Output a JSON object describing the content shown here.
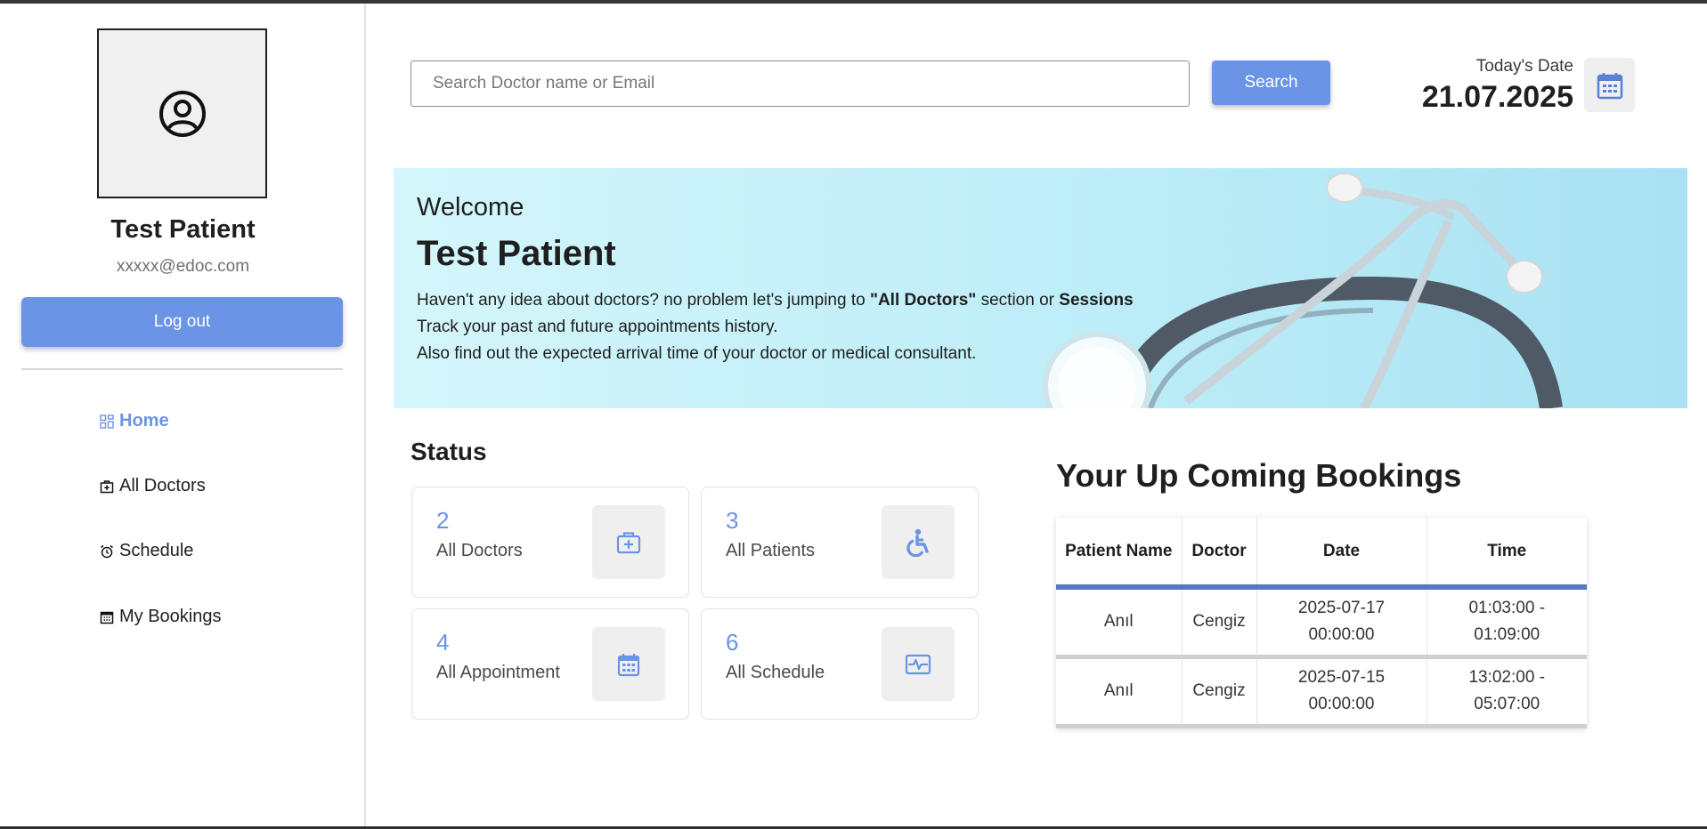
{
  "sidebar": {
    "profile_name": "Test Patient",
    "profile_email": "xxxxx@edoc.com",
    "logout_label": "Log out",
    "menu": [
      {
        "label": "Home",
        "icon": "dashboard-icon",
        "active": true
      },
      {
        "label": "All Doctors",
        "icon": "doctor-bag-icon",
        "active": false
      },
      {
        "label": "Schedule",
        "icon": "alarm-clock-icon",
        "active": false
      },
      {
        "label": "My Bookings",
        "icon": "calendar-icon",
        "active": false
      }
    ]
  },
  "topbar": {
    "search_placeholder": "Search Doctor name or Email",
    "search_label": "Search",
    "date_label": "Today's Date",
    "date_value": "21.07.2025"
  },
  "banner": {
    "welcome": "Welcome",
    "name": "Test Patient",
    "line1_prefix": "Haven't any idea about doctors? no problem let's jumping to ",
    "line1_bold1": "\"All Doctors\"",
    "line1_mid": " section or ",
    "line1_bold2": "Sessions",
    "line2": "Track your past and future appointments history.",
    "line3": "Also find out the expected arrival time of your doctor or medical consultant."
  },
  "status": {
    "title": "Status",
    "cards": [
      {
        "value": "2",
        "label": "All Doctors",
        "icon": "medical-bag-icon"
      },
      {
        "value": "3",
        "label": "All Patients",
        "icon": "wheelchair-icon"
      },
      {
        "value": "4",
        "label": "All Appointment",
        "icon": "calendar-icon"
      },
      {
        "value": "6",
        "label": "All Schedule",
        "icon": "heartbeat-icon"
      }
    ]
  },
  "bookings": {
    "title": "Your Up Coming Bookings",
    "headers": [
      "Patient Name",
      "Doctor",
      "Date",
      "Time"
    ],
    "rows": [
      {
        "patient": "Anıl",
        "doctor": "Cengiz",
        "date": "2025-07-17 00:00:00",
        "time": "01:03:00 - 01:09:00"
      },
      {
        "patient": "Anıl",
        "doctor": "Cengiz",
        "date": "2025-07-15 00:00:00",
        "time": "13:02:00 - 05:07:00"
      }
    ]
  },
  "colors": {
    "accent": "#6b93e6",
    "table_header_rule": "#5a76c0"
  }
}
